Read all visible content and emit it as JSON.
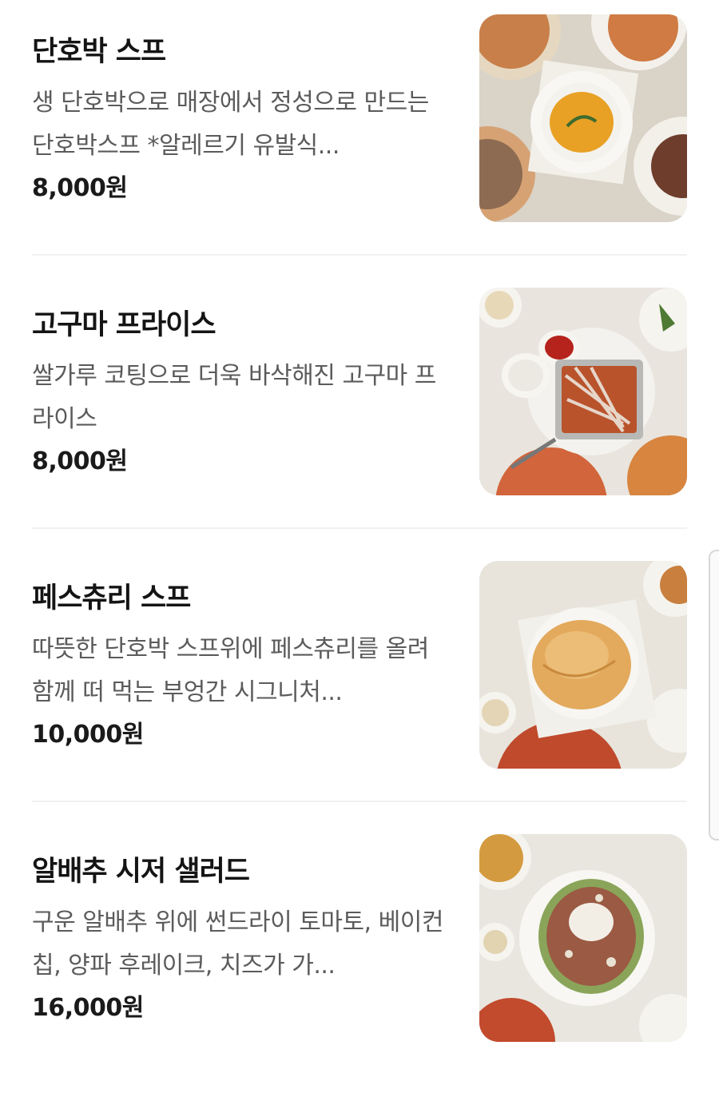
{
  "menu_items": [
    {
      "name": "단호박 스프",
      "description": "생 단호박으로 매장에서 정성으로 만드는 단호박스프 *알레르기 유발식...",
      "price": "8,000원",
      "image_icon": "pumpkin-soup-photo"
    },
    {
      "name": "고구마 프라이스",
      "description": "쌀가루 코팅으로 더욱 바삭해진 고구마 프라이스",
      "price": "8,000원",
      "image_icon": "sweet-potato-fries-photo"
    },
    {
      "name": "페스츄리 스프",
      "description": "따뜻한 단호박 스프위에 페스츄리를 올려 함께 떠 먹는 부엉간 시그니처...",
      "price": "10,000원",
      "image_icon": "pastry-soup-photo"
    },
    {
      "name": "알배추 시저 샐러드",
      "description": "구운 알배추 위에 썬드라이 토마토, 베이컨칩, 양파 후레이크, 치즈가 가...",
      "price": "16,000원",
      "image_icon": "caesar-salad-photo"
    }
  ],
  "colors": {
    "background": "#ffffff",
    "title": "#141414",
    "description": "#5b5b5b",
    "divider": "#f1f1f1"
  }
}
